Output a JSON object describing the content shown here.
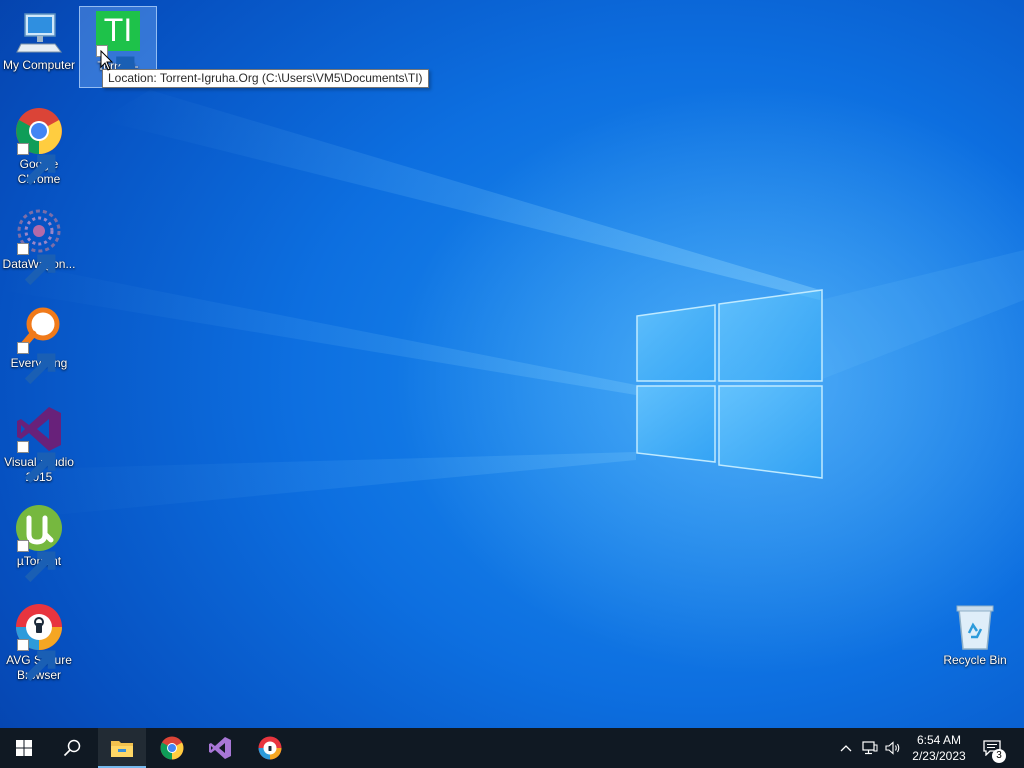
{
  "desktop": {
    "icons": [
      {
        "label": "My Computer"
      },
      {
        "label": "Torrent-Igruha.Org"
      },
      {
        "label": "Google Chrome"
      },
      {
        "label": "DataWagon..."
      },
      {
        "label": "Everything"
      },
      {
        "label": "Visual Studio 2015"
      },
      {
        "label": "µTorrent"
      },
      {
        "label": "AVG Secure Browser"
      },
      {
        "label": "Recycle Bin"
      }
    ],
    "torrent_logo_text": "TI",
    "tooltip": "Location: Torrent-Igruha.Org (C:\\Users\\VM5\\Documents\\TI)"
  },
  "taskbar": {
    "clock_time": "6:54 AM",
    "clock_date": "2/23/2023",
    "notification_count": "3",
    "accent_color": "#76b9ed",
    "background_color": "#101923"
  },
  "icons": {
    "start": "windows-logo-icon",
    "search": "search-icon",
    "explorer": "file-explorer-icon",
    "chrome": "chrome-icon",
    "visual_studio": "visual-studio-icon",
    "avg": "avg-secure-browser-icon",
    "chevron": "chevron-up-icon",
    "network": "network-icon",
    "volume": "volume-icon",
    "action_center": "action-center-icon"
  }
}
